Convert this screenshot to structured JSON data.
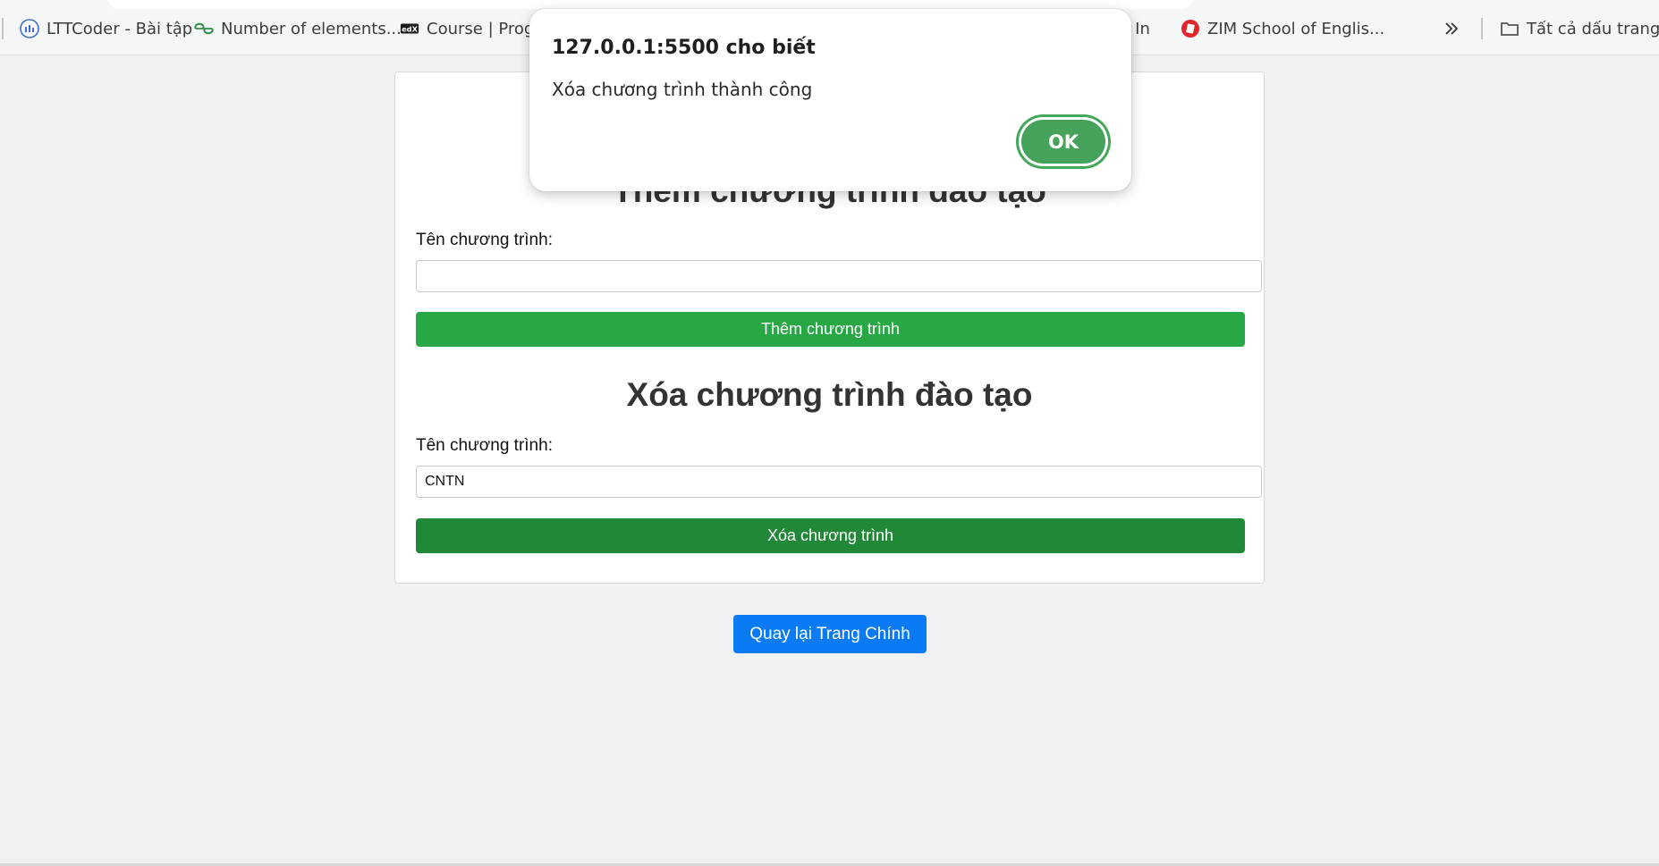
{
  "bookmarks_bar": {
    "items": [
      {
        "label": "LTTCoder - Bài tập",
        "icon": "lttcoder-icon"
      },
      {
        "label": "Number of elements...",
        "icon": "geeksforgeeks-icon"
      },
      {
        "label": "Course | Progra",
        "icon": "edx-icon"
      },
      {
        "label": "g In",
        "icon": "none"
      },
      {
        "label": "ZIM School of Englis...",
        "icon": "zim-icon"
      }
    ],
    "overflow_icon": "chevron-double-right-icon",
    "all_bookmarks_label": "Tất cả dấu trang",
    "all_bookmarks_icon": "folder-icon"
  },
  "add_section": {
    "title": "Thêm chương trình đào tạo",
    "field_label": "Tên chương trình:",
    "input_value": "",
    "button_label": "Thêm chương trình"
  },
  "delete_section": {
    "title": "Xóa chương trình đào tạo",
    "field_label": "Tên chương trình:",
    "input_value": "CNTN",
    "button_label": "Xóa chương trình"
  },
  "back_button_label": "Quay lại Trang Chính",
  "alert": {
    "title": "127.0.0.1:5500 cho biết",
    "message": "Xóa chương trình thành công",
    "ok_label": "OK"
  },
  "colors": {
    "add_button": "#28a745",
    "delete_button": "#218838",
    "back_button": "#0a7bf4",
    "ok_button": "#46a35c"
  }
}
